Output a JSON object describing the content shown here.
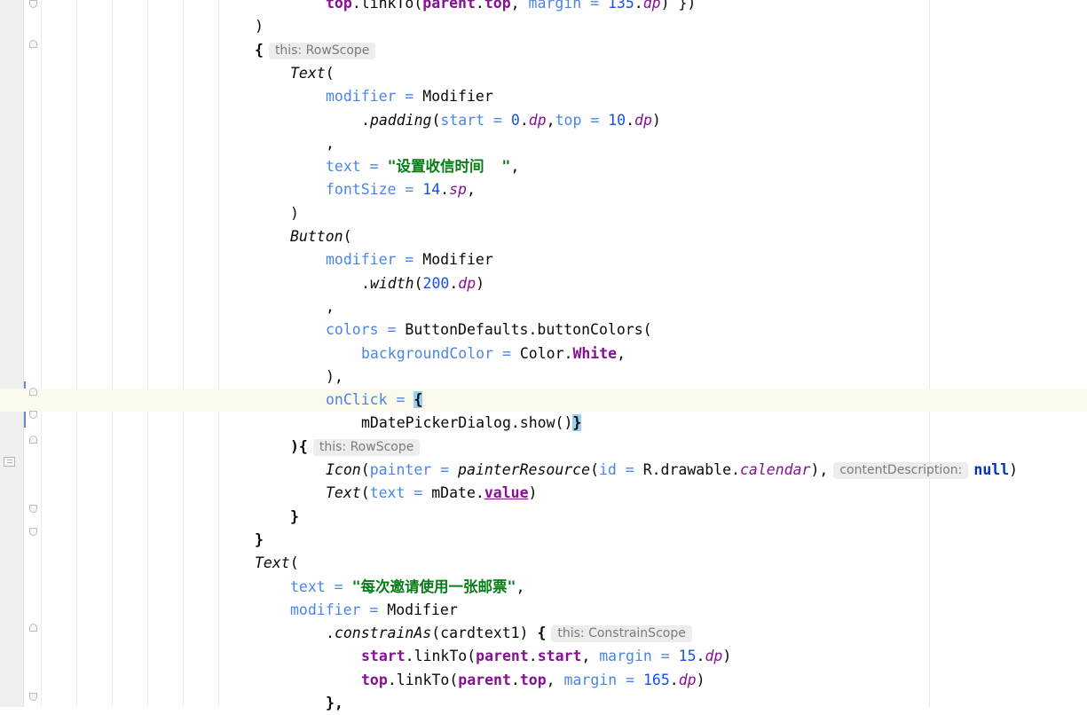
{
  "editor": {
    "lines": [
      {
        "indent": 5,
        "segments": [
          {
            "t": "top",
            "c": "prop bold"
          },
          {
            "t": ".linkTo("
          },
          {
            "t": "parent",
            "c": "prop bold"
          },
          {
            "t": "."
          },
          {
            "t": "top",
            "c": "prop bold"
          },
          {
            "t": ", "
          },
          {
            "t": "margin",
            "c": "param"
          },
          {
            "t": " = ",
            "c": "param"
          },
          {
            "t": "135",
            "c": "num"
          },
          {
            "t": "."
          },
          {
            "t": "dp",
            "c": "ext"
          },
          {
            "t": ")"
          },
          {
            "t": " }"
          },
          {
            "t": ")"
          }
        ]
      },
      {
        "indent": 3,
        "segments": [
          {
            "t": ")"
          }
        ]
      },
      {
        "indent": 3,
        "segments": [
          {
            "t": "{",
            "c": "bold"
          },
          {
            "hint": "this: RowScope"
          }
        ]
      },
      {
        "indent": 4,
        "segments": [
          {
            "t": "Text",
            "c": "fn"
          },
          {
            "t": "("
          }
        ]
      },
      {
        "indent": 5,
        "segments": [
          {
            "t": "modifier",
            "c": "param"
          },
          {
            "t": " = ",
            "c": "param"
          },
          {
            "t": "Modifier"
          }
        ]
      },
      {
        "indent": 6,
        "segments": [
          {
            "t": "."
          },
          {
            "t": "padding",
            "c": "fn"
          },
          {
            "t": "("
          },
          {
            "t": "start",
            "c": "param"
          },
          {
            "t": " = ",
            "c": "param"
          },
          {
            "t": "0",
            "c": "num"
          },
          {
            "t": "."
          },
          {
            "t": "dp",
            "c": "ext"
          },
          {
            "t": ","
          },
          {
            "t": "top",
            "c": "param"
          },
          {
            "t": " = ",
            "c": "param"
          },
          {
            "t": "10",
            "c": "num"
          },
          {
            "t": "."
          },
          {
            "t": "dp",
            "c": "ext"
          },
          {
            "t": ")"
          }
        ]
      },
      {
        "indent": 5,
        "segments": [
          {
            "t": ","
          }
        ]
      },
      {
        "indent": 5,
        "segments": [
          {
            "t": "text",
            "c": "param"
          },
          {
            "t": " = ",
            "c": "param"
          },
          {
            "t": "\"设置收信时间  \"",
            "c": "str"
          },
          {
            "t": ","
          }
        ]
      },
      {
        "indent": 5,
        "segments": [
          {
            "t": "fontSize",
            "c": "param"
          },
          {
            "t": " = ",
            "c": "param"
          },
          {
            "t": "14",
            "c": "num"
          },
          {
            "t": "."
          },
          {
            "t": "sp",
            "c": "ext"
          },
          {
            "t": ","
          }
        ]
      },
      {
        "indent": 4,
        "segments": [
          {
            "t": ")"
          }
        ]
      },
      {
        "indent": 4,
        "segments": [
          {
            "t": "Button",
            "c": "fn"
          },
          {
            "t": "("
          }
        ]
      },
      {
        "indent": 5,
        "segments": [
          {
            "t": "modifier",
            "c": "param"
          },
          {
            "t": " = ",
            "c": "param"
          },
          {
            "t": "Modifier"
          }
        ]
      },
      {
        "indent": 6,
        "segments": [
          {
            "t": "."
          },
          {
            "t": "width",
            "c": "fn"
          },
          {
            "t": "("
          },
          {
            "t": "200",
            "c": "num"
          },
          {
            "t": "."
          },
          {
            "t": "dp",
            "c": "ext"
          },
          {
            "t": ")"
          }
        ]
      },
      {
        "indent": 5,
        "segments": [
          {
            "t": ","
          }
        ]
      },
      {
        "indent": 5,
        "segments": [
          {
            "t": "colors",
            "c": "param"
          },
          {
            "t": " = ",
            "c": "param"
          },
          {
            "t": "ButtonDefaults.buttonColors("
          }
        ]
      },
      {
        "indent": 6,
        "segments": [
          {
            "t": "backgroundColor",
            "c": "param"
          },
          {
            "t": " = ",
            "c": "param"
          },
          {
            "t": "Color."
          },
          {
            "t": "White",
            "c": "prop bold"
          },
          {
            "t": ","
          }
        ]
      },
      {
        "indent": 5,
        "segments": [
          {
            "t": "),"
          }
        ]
      },
      {
        "indent": 5,
        "caret": true,
        "segments": [
          {
            "t": "onClick",
            "c": "param"
          },
          {
            "t": " = ",
            "c": "param"
          },
          {
            "t": "{",
            "c": "bold brace-hl"
          }
        ]
      },
      {
        "indent": 6,
        "segments": [
          {
            "t": "mDatePickerDialog.show()"
          },
          {
            "t": "}",
            "c": "bold brace-hl"
          }
        ]
      },
      {
        "indent": 4,
        "segments": [
          {
            "t": "){",
            "c": "bold"
          },
          {
            "hint": "this: RowScope"
          }
        ]
      },
      {
        "indent": 5,
        "segments": [
          {
            "t": "Icon",
            "c": "fn"
          },
          {
            "t": "("
          },
          {
            "t": "painter",
            "c": "param"
          },
          {
            "t": " = ",
            "c": "param"
          },
          {
            "t": "painterResource",
            "c": "fn"
          },
          {
            "t": "("
          },
          {
            "t": "id",
            "c": "param"
          },
          {
            "t": " = ",
            "c": "param"
          },
          {
            "t": "R.drawable."
          },
          {
            "t": "calendar",
            "c": "ext"
          },
          {
            "t": "),"
          },
          {
            "hint": "contentDescription:"
          },
          {
            "t": "null",
            "c": "kw bold"
          },
          {
            "t": ")"
          }
        ]
      },
      {
        "indent": 5,
        "segments": [
          {
            "t": "Text",
            "c": "fn"
          },
          {
            "t": "("
          },
          {
            "t": "text",
            "c": "param"
          },
          {
            "t": " = ",
            "c": "param"
          },
          {
            "t": "mDate."
          },
          {
            "t": "value",
            "c": "prop bold und"
          },
          {
            "t": ")"
          }
        ]
      },
      {
        "indent": 4,
        "segments": [
          {
            "t": "}",
            "c": "bold"
          }
        ]
      },
      {
        "indent": 3,
        "segments": [
          {
            "t": "}",
            "c": "bold"
          }
        ]
      },
      {
        "indent": 3,
        "segments": [
          {
            "t": "Text",
            "c": "fn"
          },
          {
            "t": "("
          }
        ]
      },
      {
        "indent": 4,
        "segments": [
          {
            "t": "text",
            "c": "param"
          },
          {
            "t": " = ",
            "c": "param"
          },
          {
            "t": "\"每次邀请使用一张邮票\"",
            "c": "str"
          },
          {
            "t": ","
          }
        ]
      },
      {
        "indent": 4,
        "segments": [
          {
            "t": "modifier",
            "c": "param"
          },
          {
            "t": " = ",
            "c": "param"
          },
          {
            "t": "Modifier"
          }
        ]
      },
      {
        "indent": 5,
        "segments": [
          {
            "t": "."
          },
          {
            "t": "constrainAs",
            "c": "fn"
          },
          {
            "t": "(cardtext1) "
          },
          {
            "t": "{",
            "c": "bold"
          },
          {
            "hint": "this: ConstrainScope"
          }
        ]
      },
      {
        "indent": 6,
        "segments": [
          {
            "t": "start",
            "c": "prop bold"
          },
          {
            "t": ".linkTo("
          },
          {
            "t": "parent",
            "c": "prop bold"
          },
          {
            "t": "."
          },
          {
            "t": "start",
            "c": "prop bold"
          },
          {
            "t": ", "
          },
          {
            "t": "margin",
            "c": "param"
          },
          {
            "t": " = ",
            "c": "param"
          },
          {
            "t": "15",
            "c": "num"
          },
          {
            "t": "."
          },
          {
            "t": "dp",
            "c": "ext"
          },
          {
            "t": ")"
          }
        ]
      },
      {
        "indent": 6,
        "segments": [
          {
            "t": "top",
            "c": "prop bold"
          },
          {
            "t": ".linkTo("
          },
          {
            "t": "parent",
            "c": "prop bold"
          },
          {
            "t": "."
          },
          {
            "t": "top",
            "c": "prop bold"
          },
          {
            "t": ", "
          },
          {
            "t": "margin",
            "c": "param"
          },
          {
            "t": " = ",
            "c": "param"
          },
          {
            "t": "165",
            "c": "num"
          },
          {
            "t": "."
          },
          {
            "t": "dp",
            "c": "ext"
          },
          {
            "t": ")"
          }
        ]
      },
      {
        "indent": 5,
        "segments": [
          {
            "t": "},",
            "c": "bold"
          }
        ]
      }
    ]
  }
}
